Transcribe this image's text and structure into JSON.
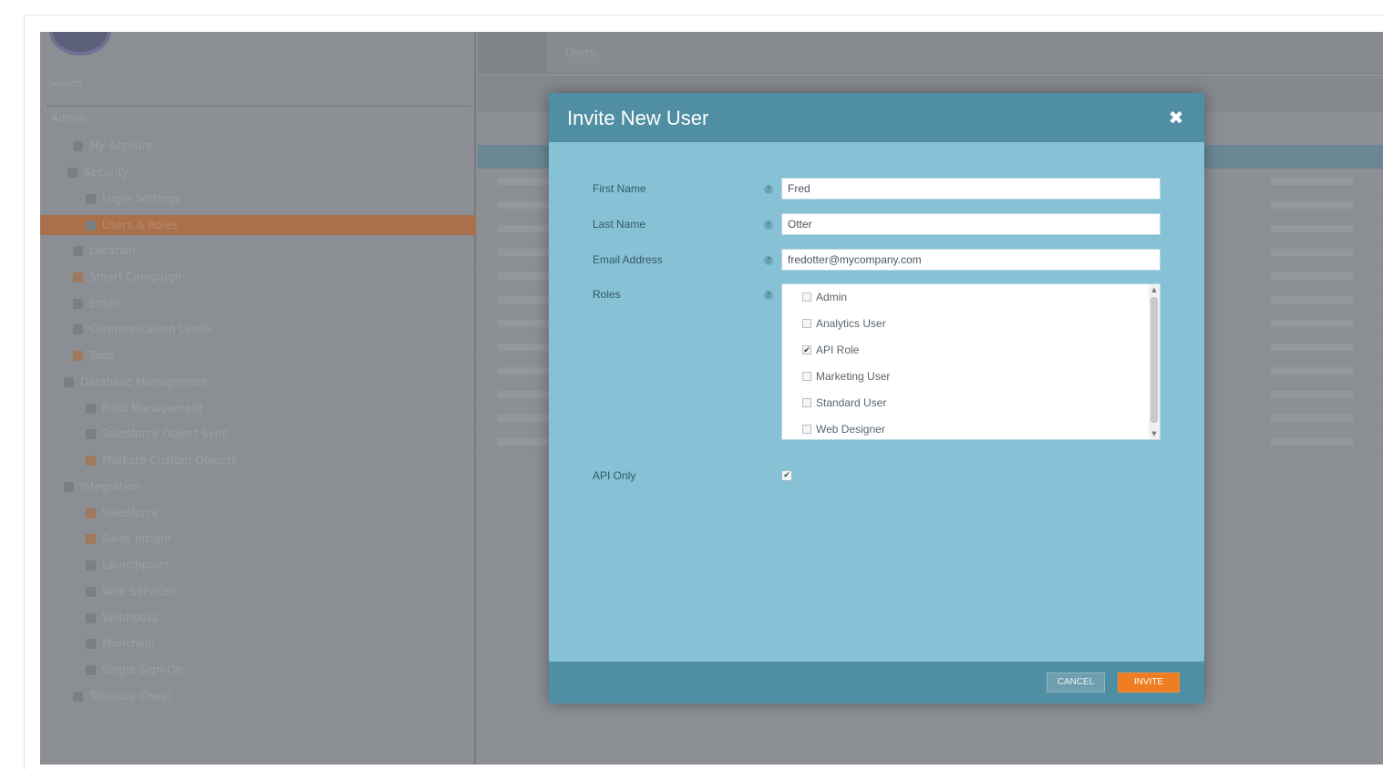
{
  "sidebar": {
    "search_placeholder": "Search",
    "section_label": "Admin",
    "items": [
      {
        "label": "My Account",
        "icon": "person-icon"
      },
      {
        "label": "Security",
        "icon": "lock-icon"
      },
      {
        "label": "Login Settings",
        "icon": "gear-icon"
      },
      {
        "label": "Users & Roles",
        "icon": "users-icon"
      },
      {
        "label": "Location",
        "icon": "globe-icon"
      },
      {
        "label": "Smart Campaign",
        "icon": "campaign-icon"
      },
      {
        "label": "Email",
        "icon": "mail-icon"
      },
      {
        "label": "Communication Limits",
        "icon": "limits-icon"
      },
      {
        "label": "Tags",
        "icon": "tag-icon"
      },
      {
        "label": "Database Management",
        "icon": "database-icon"
      },
      {
        "label": "Field Management",
        "icon": "field-icon"
      },
      {
        "label": "Salesforce Object Sync",
        "icon": "sync-icon"
      },
      {
        "label": "Marketo Custom Objects",
        "icon": "objects-icon"
      },
      {
        "label": "Integration",
        "icon": "integration-icon"
      },
      {
        "label": "Salesforce",
        "icon": "salesforce-icon"
      },
      {
        "label": "Sales Insight",
        "icon": "insight-icon"
      },
      {
        "label": "Launchpoint",
        "icon": "launch-icon"
      },
      {
        "label": "Web Services",
        "icon": "web-icon"
      },
      {
        "label": "Webhooks",
        "icon": "webhook-icon"
      },
      {
        "label": "Munchkin",
        "icon": "munchkin-icon"
      },
      {
        "label": "Single Sign-On",
        "icon": "sso-icon"
      },
      {
        "label": "Treasure Chest",
        "icon": "chest-icon"
      }
    ],
    "active_index": 3
  },
  "main": {
    "tab_label": "Users"
  },
  "modal": {
    "title": "Invite New User",
    "close_icon": "close-icon",
    "fields": {
      "first_name": {
        "label": "First Name",
        "value": "Fred"
      },
      "last_name": {
        "label": "Last Name",
        "value": "Otter"
      },
      "email": {
        "label": "Email Address",
        "value": "fredotter@mycompany.com"
      },
      "roles": {
        "label": "Roles",
        "options": [
          {
            "label": "Admin",
            "checked": false
          },
          {
            "label": "Analytics User",
            "checked": false
          },
          {
            "label": "API Role",
            "checked": true
          },
          {
            "label": "Marketing User",
            "checked": false
          },
          {
            "label": "Standard User",
            "checked": false
          },
          {
            "label": "Web Designer",
            "checked": false
          }
        ]
      },
      "api_only": {
        "label": "API Only",
        "checked": true
      }
    },
    "help_glyph": "?",
    "buttons": {
      "cancel": "CANCEL",
      "invite": "INVITE"
    }
  },
  "colors": {
    "modal_header": "#4f8ea3",
    "modal_body": "#86c1d5",
    "invite_button": "#ef7d22",
    "active_sidebar": "#a8704b"
  }
}
